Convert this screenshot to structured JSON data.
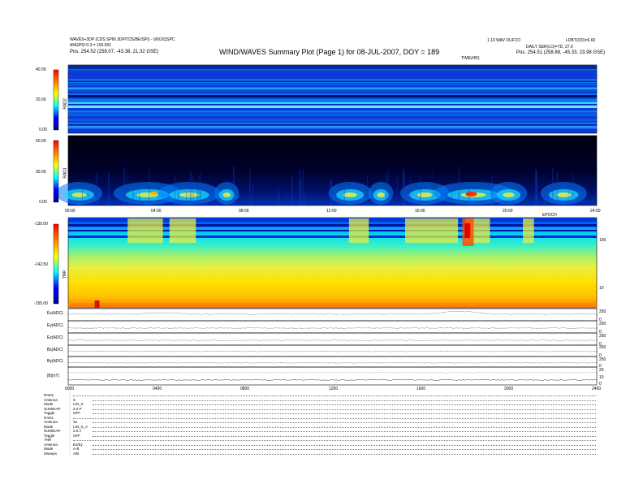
{
  "header": {
    "title": "WIND/WAVES Summary Plot (Page 1) for 08-JUL-2007, DOY = 189",
    "left_line1": "WAVES+3DP (CDS SPIN 3DP/TDS/BE/SPI) - 0/0/2/QSPC",
    "left_line2": "ANGPSI 0.3 = 103.001",
    "left_line3": "Pos.    254.52 (258.07, -43.38, 21.32 GSE)",
    "right_line1": "LDBT(OD)=6.60",
    "right_line2": "DAILY SER(LO)=TD, 27.0",
    "right_line3": "Pos.    254.51 (258.88, -45.33, 23.98 GSE)",
    "center_small": "1.10 WAV DUFCO",
    "time_unit_top": "TIME(HR)",
    "ut_tag": "EPOCH"
  },
  "chart_data": [
    {
      "type": "heatmap",
      "panel": "RAD2",
      "colorbar_ticks": [
        "40.00",
        "20.00",
        "0.00"
      ],
      "zlim": [
        0,
        40
      ],
      "xlim": [
        0,
        24
      ],
      "description_level": "noise-dominated high frequency receiver"
    },
    {
      "type": "heatmap",
      "panel": "RAD1",
      "colorbar_ticks": [
        "60.00",
        "30.00",
        "0.00"
      ],
      "zlim": [
        0,
        60
      ],
      "x_ticks": [
        "00:00",
        "04:00",
        "08:00",
        "12:00",
        "16:00",
        "20:00",
        "24:00"
      ],
      "xlim": [
        0,
        24
      ]
    },
    {
      "type": "heatmap",
      "panel": "TNR",
      "colorbar_ticks": [
        "-130.00",
        "-142.50",
        "-155.00"
      ],
      "zlim": [
        -155,
        -130
      ],
      "right_ticks": [
        "100",
        "10"
      ],
      "xlim": [
        0,
        24
      ]
    },
    {
      "type": "line",
      "panels": [
        {
          "name": "Ex(ADC)",
          "right_ticks": [
            "250",
            "0"
          ]
        },
        {
          "name": "Ey(ADC)",
          "right_ticks": [
            "250",
            "0"
          ]
        },
        {
          "name": "Ez(ADC)",
          "right_ticks": [
            "250",
            "0"
          ]
        },
        {
          "name": "Bx(ADC)",
          "right_ticks": [
            "250",
            "0"
          ]
        },
        {
          "name": "By(ADC)",
          "right_ticks": [
            "250",
            "0"
          ]
        },
        {
          "name": "|B|(nT)",
          "right_ticks": [
            "20",
            "10",
            "0"
          ]
        }
      ],
      "x_ticks": [
        "0000",
        "0400",
        "0800",
        "1200",
        "1600",
        "2000",
        "2400"
      ],
      "xlim": [
        0,
        24
      ]
    }
  ],
  "settings": {
    "groups": [
      {
        "name": "RAD2",
        "rows": [
          [
            "Antenna",
            "S"
          ],
          [
            "Mode",
            "LIN_S"
          ],
          [
            "SUMDIAP",
            "2.0 P"
          ],
          [
            "Toggle",
            "OFF"
          ]
        ]
      },
      {
        "name": "RAD1",
        "rows": [
          [
            "Antenna",
            "Sx"
          ],
          [
            "Mode",
            "LIN_S_A"
          ],
          [
            "SUMDIAP",
            "2.0 A"
          ],
          [
            "Toggle",
            "OFF"
          ]
        ]
      },
      {
        "name": "TNR",
        "rows": [
          [
            "Antenna",
            "Ex/Ey"
          ],
          [
            "Mode",
            "A-B"
          ],
          [
            "Sweeps",
            "A/B"
          ]
        ]
      }
    ]
  }
}
